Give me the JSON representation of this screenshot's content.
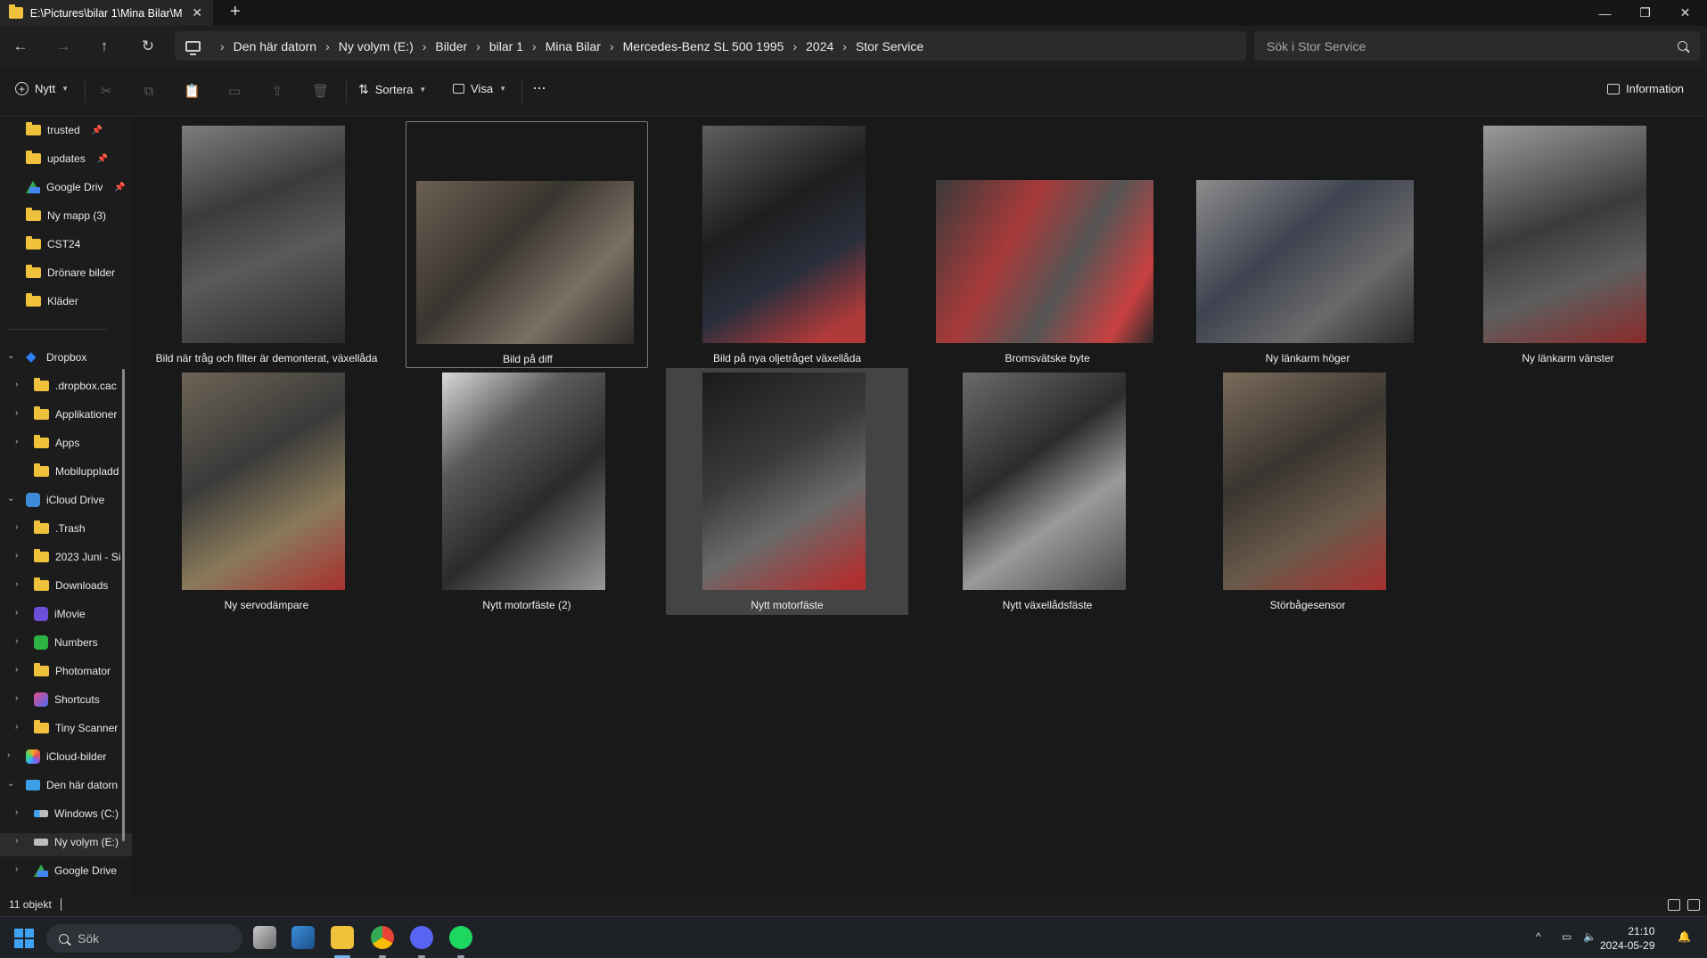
{
  "window": {
    "tab_title": "E:\\Pictures\\bilar 1\\Mina Bilar\\M",
    "tab_close": "✕",
    "new_tab": "+",
    "controls": {
      "minimize": "—",
      "maximize": "❐",
      "close": "✕"
    }
  },
  "nav": {
    "back": "←",
    "forward": "→",
    "up": "↑",
    "refresh": "↻",
    "breadcrumb": [
      "Den här datorn",
      "Ny volym (E:)",
      "Bilder",
      "bilar 1",
      "Mina Bilar",
      "Mercedes-Benz SL 500 1995",
      "2024",
      "Stor Service"
    ],
    "separator": "›",
    "search_placeholder": "Sök i Stor Service"
  },
  "toolbar": {
    "new_label": "Nytt",
    "sort_label": "Sortera",
    "view_label": "Visa",
    "more_label": "···",
    "details_label": "Information"
  },
  "sidebar": {
    "pinned": [
      {
        "label": "trusted",
        "icon": "folder-icon",
        "pinned": true
      },
      {
        "label": "updates",
        "icon": "folder-icon",
        "pinned": true
      },
      {
        "label": "Google Driv",
        "icon": "google-drive-icon",
        "pinned": true
      },
      {
        "label": "Ny mapp (3)",
        "icon": "folder-icon"
      },
      {
        "label": "CST24",
        "icon": "folder-icon"
      },
      {
        "label": "Drönare bilder",
        "icon": "folder-icon"
      },
      {
        "label": "Kläder",
        "icon": "folder-icon"
      }
    ],
    "tree": [
      {
        "label": "Dropbox",
        "icon": "dropbox-icon",
        "level": 0,
        "expanded": true
      },
      {
        "label": ".dropbox.cac",
        "icon": "folder-icon",
        "level": 1
      },
      {
        "label": "Applikationer",
        "icon": "folder-icon",
        "level": 1
      },
      {
        "label": "Apps",
        "icon": "folder-icon",
        "level": 1
      },
      {
        "label": "Mobiluppladd",
        "icon": "folder-icon",
        "level": 1
      },
      {
        "label": "iCloud Drive",
        "icon": "icloud-icon",
        "level": 0,
        "expanded": true
      },
      {
        "label": ".Trash",
        "icon": "folder-icon",
        "level": 1
      },
      {
        "label": "2023 Juni - Si",
        "icon": "folder-icon",
        "level": 1
      },
      {
        "label": "Downloads",
        "icon": "folder-icon",
        "level": 1
      },
      {
        "label": "iMovie",
        "icon": "imovie-icon",
        "level": 1
      },
      {
        "label": "Numbers",
        "icon": "numbers-icon",
        "level": 1
      },
      {
        "label": "Photomator",
        "icon": "folder-icon",
        "level": 1
      },
      {
        "label": "Shortcuts",
        "icon": "shortcuts-icon",
        "level": 1
      },
      {
        "label": "Tiny Scanner",
        "icon": "folder-icon",
        "level": 1
      },
      {
        "label": "iCloud-bilder",
        "icon": "icloud-photos-icon",
        "level": 0
      },
      {
        "label": "Den här datorn",
        "icon": "this-pc-icon",
        "level": 0,
        "expanded": true
      },
      {
        "label": "Windows (C:)",
        "icon": "windows-drive-icon",
        "level": 1
      },
      {
        "label": "Ny volym (E:)",
        "icon": "drive-icon",
        "level": 1
      },
      {
        "label": "Google Drive",
        "icon": "google-drive-icon",
        "level": 1
      }
    ]
  },
  "files": [
    {
      "name": "Bild när tråg och filter är demonterat, växellåda",
      "orientation": "portrait",
      "state": "normal"
    },
    {
      "name": "Bild på diff",
      "orientation": "landscape",
      "state": "focused"
    },
    {
      "name": "Bild på nya oljetråget växellåda",
      "orientation": "portrait",
      "state": "normal"
    },
    {
      "name": "Bromsvätske byte",
      "orientation": "landscape",
      "state": "normal"
    },
    {
      "name": "Ny länkarm höger",
      "orientation": "landscape",
      "state": "normal"
    },
    {
      "name": "Ny länkarm vänster",
      "orientation": "portrait",
      "state": "normal"
    },
    {
      "name": "Ny servodämpare",
      "orientation": "portrait",
      "state": "normal"
    },
    {
      "name": "Nytt motorfäste (2)",
      "orientation": "portrait",
      "state": "normal"
    },
    {
      "name": "Nytt motorfäste",
      "orientation": "portrait",
      "state": "selected"
    },
    {
      "name": "Nytt växellådsfäste",
      "orientation": "portrait",
      "state": "normal"
    },
    {
      "name": "Störbågesensor",
      "orientation": "portrait",
      "state": "normal"
    }
  ],
  "status": {
    "count": "11 objekt"
  },
  "taskbar": {
    "search_label": "Sök",
    "time": "21:10",
    "date": "2024-05-29"
  },
  "colors": {
    "folder": "#f0c23c",
    "accent": "#3ea2f4",
    "background": "#191919"
  }
}
